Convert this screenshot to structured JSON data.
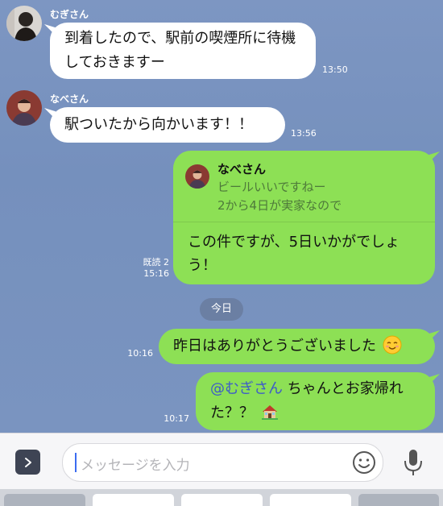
{
  "messages": {
    "m1": {
      "sender": "むぎさん",
      "text": "到着したので、駅前の喫煙所に待機しておきますー",
      "time": "13:50"
    },
    "m2": {
      "sender": "なべさん",
      "text": "駅ついたから向かいます！！",
      "time": "13:56"
    },
    "m3": {
      "reply_sender": "なべさん",
      "reply_text": "ビールいいですねー\n2から4日が実家なので",
      "text": "この件ですが、5日いかがでしょう！",
      "read_status": "既読 2",
      "time": "15:16"
    },
    "date_divider": "今日",
    "m4": {
      "text": "昨日はありがとうございました",
      "time": "10:16"
    },
    "m5": {
      "mention": "@むぎさん",
      "text": " ちゃんとお家帰れた？？",
      "time": "10:17"
    }
  },
  "input": {
    "placeholder": "メッセージを入力"
  },
  "icons": {
    "expand": "chevron-right-icon",
    "emoji": "smiley-icon",
    "mic": "microphone-icon",
    "relieved": "relieved-face-emoji",
    "house": "house-emoji"
  },
  "colors": {
    "background": "#7a93bf",
    "bubble_outgoing": "#8de055",
    "bubble_incoming": "#ffffff",
    "mention": "#3d5bc9"
  }
}
